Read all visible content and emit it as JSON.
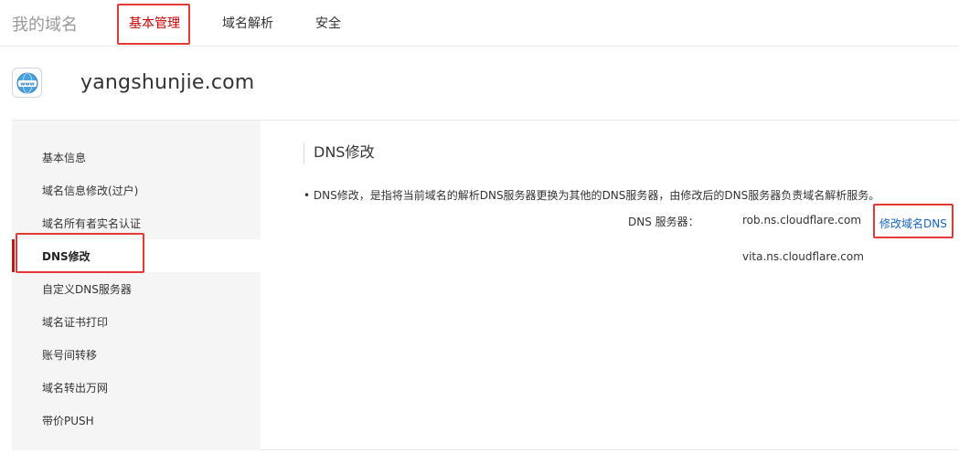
{
  "topnav": {
    "brand": "我的域名",
    "tabs": [
      {
        "label": "基本管理"
      },
      {
        "label": "域名解析"
      },
      {
        "label": "安全"
      }
    ]
  },
  "domain": {
    "name": "yangshunjie.com",
    "icon": "www-globe-icon",
    "icon_text": "www"
  },
  "sidebar": {
    "items": [
      {
        "label": "基本信息"
      },
      {
        "label": "域名信息修改(过户)"
      },
      {
        "label": "域名所有者实名认证"
      },
      {
        "label": "DNS修改"
      },
      {
        "label": "自定义DNS服务器"
      },
      {
        "label": "域名证书打印"
      },
      {
        "label": "账号间转移"
      },
      {
        "label": "域名转出万网"
      },
      {
        "label": "带价PUSH"
      }
    ],
    "active_index": 3
  },
  "main": {
    "title": "DNS修改",
    "description": "• DNS修改，是指将当前域名的解析DNS服务器更换为其他的DNS服务器，由修改后的DNS服务器负责域名解析服务。",
    "dns_label": "DNS 服务器：",
    "nameservers": [
      "rob.ns.cloudflare.com",
      "vita.ns.cloudflare.com"
    ],
    "modify_link": "修改域名DNS"
  },
  "colors": {
    "accent_red": "#cc0000",
    "highlight_box": "#e53935",
    "link_blue": "#1565c0",
    "sidebar_bg": "#f5f5f5"
  }
}
